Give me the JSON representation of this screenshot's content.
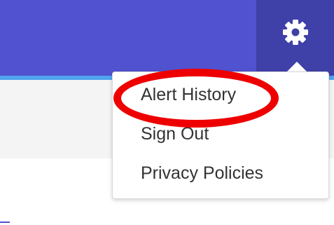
{
  "header": {
    "settings_icon": "gear-icon",
    "brand_color": "#5152cf",
    "settings_button_color": "#3f40a8",
    "accent_strip_color": "#50a5ee"
  },
  "settings_menu": {
    "items": [
      {
        "label": "Alert History"
      },
      {
        "label": "Sign Out"
      },
      {
        "label": "Privacy Policies"
      }
    ],
    "highlight_color": "#ee0000"
  }
}
